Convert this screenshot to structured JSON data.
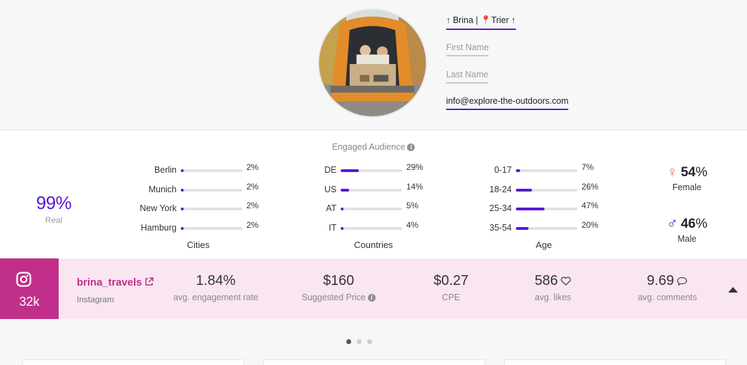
{
  "profile": {
    "display_name": "↑ Brina | 📍Trier ↑",
    "first_name_placeholder": "First Name",
    "last_name_placeholder": "Last Name",
    "email": "info@explore-the-outdoors.com",
    "avatar_icon": "avatar-photo"
  },
  "audience": {
    "title": "Engaged Audience",
    "real": {
      "value": "99%",
      "label": "Real"
    },
    "cities": {
      "label": "Cities",
      "rows": [
        {
          "name": "Berlin",
          "pct": "2%",
          "value": 2
        },
        {
          "name": "Munich",
          "pct": "2%",
          "value": 2
        },
        {
          "name": "New York",
          "pct": "2%",
          "value": 2
        },
        {
          "name": "Hamburg",
          "pct": "2%",
          "value": 2
        }
      ]
    },
    "countries": {
      "label": "Countries",
      "rows": [
        {
          "name": "DE",
          "pct": "29%",
          "value": 29
        },
        {
          "name": "US",
          "pct": "14%",
          "value": 14
        },
        {
          "name": "AT",
          "pct": "5%",
          "value": 5
        },
        {
          "name": "IT",
          "pct": "4%",
          "value": 4
        }
      ]
    },
    "age": {
      "label": "Age",
      "rows": [
        {
          "name": "0-17",
          "pct": "7%",
          "value": 7
        },
        {
          "name": "18-24",
          "pct": "26%",
          "value": 26
        },
        {
          "name": "25-34",
          "pct": "47%",
          "value": 47
        },
        {
          "name": "35-54",
          "pct": "20%",
          "value": 20
        }
      ]
    },
    "gender": {
      "female": {
        "symbol": "♀",
        "value": "54",
        "unit": "%",
        "label": "Female"
      },
      "male": {
        "symbol": "♂",
        "value": "46",
        "unit": "%",
        "label": "Male"
      }
    }
  },
  "instagram": {
    "followers": "32k",
    "handle": "brina_travels",
    "platform": "Instagram",
    "metrics": {
      "engagement": {
        "value": "1.84%",
        "label": "avg. engagement rate"
      },
      "price": {
        "value": "$160",
        "label": "Suggested Price"
      },
      "cpe": {
        "value": "$0.27",
        "label": "CPE"
      },
      "likes": {
        "value": "586",
        "label": "avg. likes"
      },
      "comments": {
        "value": "9.69",
        "label": "avg. comments"
      }
    }
  },
  "pager": {
    "total": 3,
    "active": 1
  },
  "colors": {
    "accent": "#5a16d6",
    "instagram": "#c02f8a",
    "instagram_bg": "#f9e6f1",
    "female": "#e8705b"
  }
}
